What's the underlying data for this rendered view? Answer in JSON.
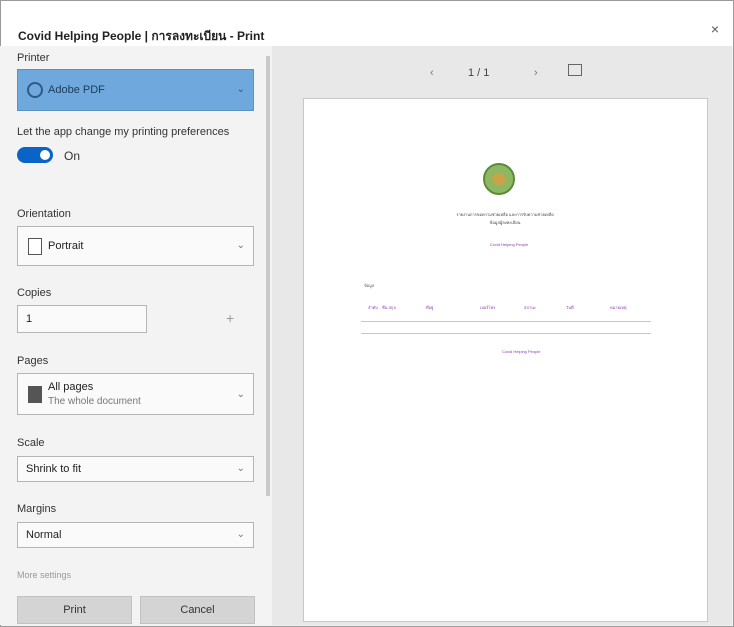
{
  "dialog": {
    "title": "Covid Helping People | การลงทะเบียน - Print",
    "close_symbol": "×"
  },
  "printer": {
    "label": "Printer",
    "value": "Adobe PDF"
  },
  "preferences": {
    "label": "Let the app change my printing preferences",
    "toggle_state": "On"
  },
  "orientation": {
    "label": "Orientation",
    "value": "Portrait"
  },
  "copies": {
    "label": "Copies",
    "value": "1",
    "increment_symbol": "+"
  },
  "pages": {
    "label": "Pages",
    "value": "All pages",
    "subtext": "The whole document"
  },
  "scale": {
    "label": "Scale",
    "value": "Shrink to fit"
  },
  "margins": {
    "label": "Margins",
    "value": "Normal"
  },
  "more_settings": {
    "label": "More settings"
  },
  "buttons": {
    "print": "Print",
    "cancel": "Cancel"
  },
  "preview": {
    "page_indicator": "1 / 1",
    "document": {
      "heading": "รายงานการขอความช่วยเหลือ และการรับความช่วยเหลือ",
      "subheading": "ข้อมูลผู้ลงทะเบียน",
      "link_line": "Covid Helping People",
      "table_label": "ข้อมูล",
      "columns": [
        "ลำดับ",
        "ชื่อ-สกุล",
        "ที่อยู่",
        "เบอร์โทร",
        "สถานะ",
        "วันที่",
        "หมายเหตุ"
      ],
      "footer_link": "Covid Helping People"
    }
  }
}
